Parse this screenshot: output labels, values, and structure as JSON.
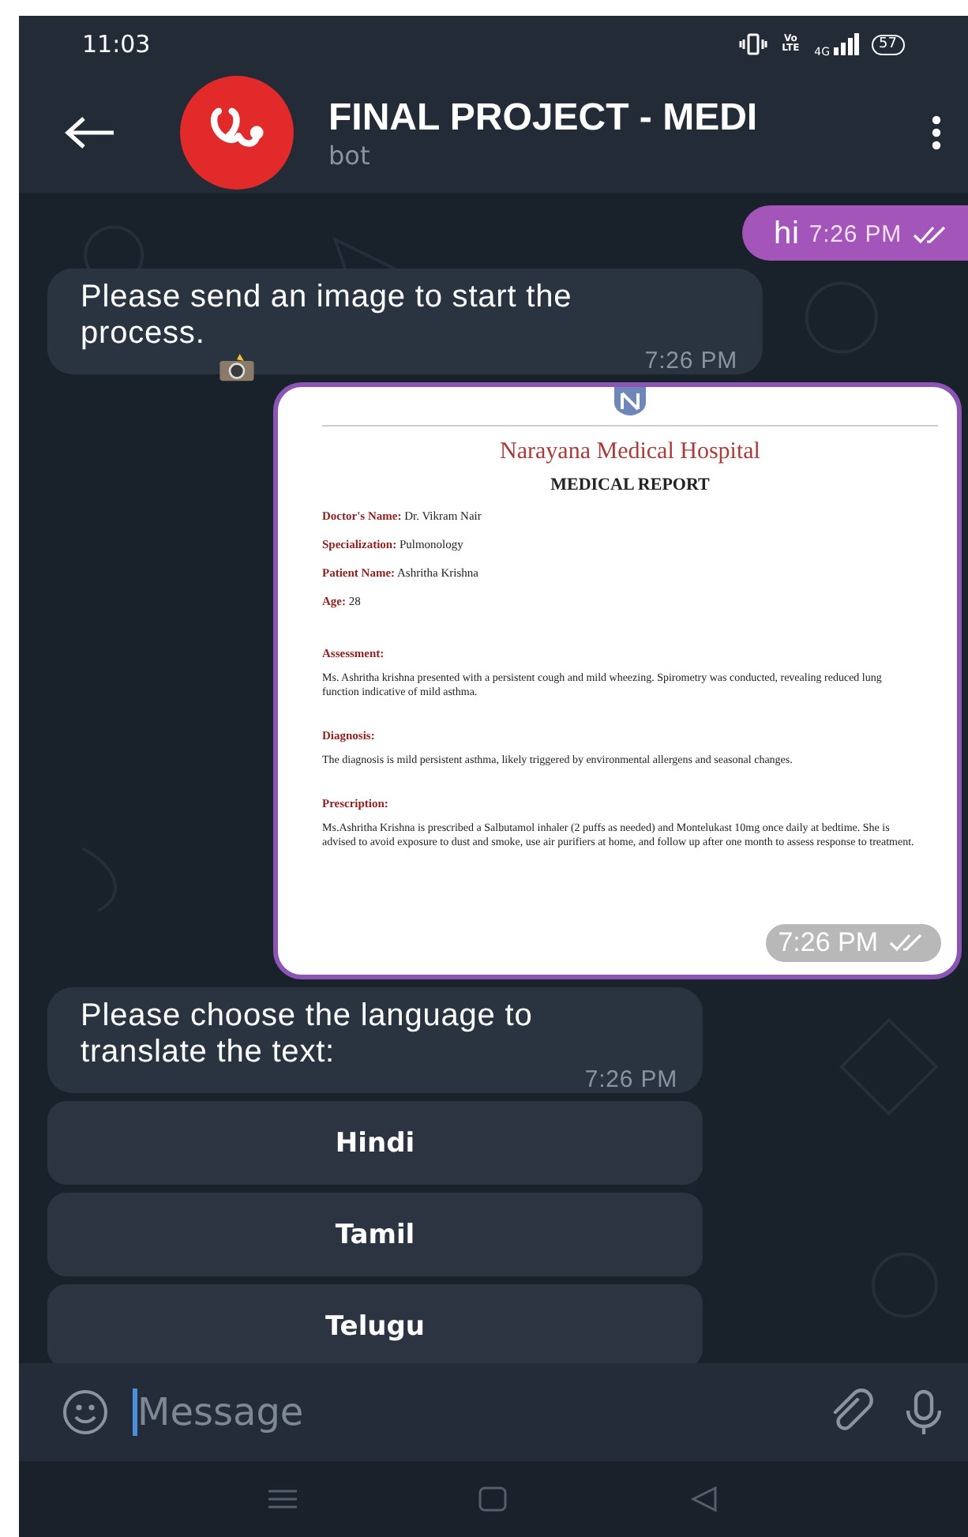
{
  "status_bar": {
    "time": "11:03",
    "volte": "Vo LTE",
    "network": "4G",
    "battery": "57"
  },
  "header": {
    "title": "FINAL PROJECT - MEDI",
    "subtitle": "bot"
  },
  "messages": [
    {
      "kind": "text",
      "outgoing": true,
      "text": "hi",
      "time": "7:26 PM",
      "read": true
    },
    {
      "kind": "text",
      "outgoing": false,
      "text": "Please send an image to start the process.",
      "time": "7:26 PM"
    },
    {
      "kind": "image",
      "outgoing": true,
      "time": "7:26 PM",
      "read": true,
      "document": {
        "hospital": "Narayana Medical Hospital",
        "title": "MEDICAL REPORT",
        "fields": [
          {
            "label": "Doctor's Name:",
            "value": "Dr. Vikram Nair"
          },
          {
            "label": "Specialization:",
            "value": "Pulmonology"
          },
          {
            "label": "Patient Name:",
            "value": "Ashritha Krishna"
          },
          {
            "label": "Age:",
            "value": "28"
          }
        ],
        "sections": [
          {
            "heading": "Assessment:",
            "text": "Ms. Ashritha krishna presented with a persistent cough and mild wheezing. Spirometry was conducted, revealing reduced lung function indicative of mild asthma."
          },
          {
            "heading": "Diagnosis:",
            "text": "The diagnosis is mild persistent asthma, likely triggered by environmental allergens and seasonal changes."
          },
          {
            "heading": "Prescription:",
            "text": "Ms.Ashritha Krishna is prescribed a Salbutamol inhaler (2 puffs as needed) and Montelukast 10mg once daily at bedtime. She is advised to avoid exposure to dust and smoke, use air purifiers at home, and follow up after one month to assess response to treatment."
          }
        ]
      }
    },
    {
      "kind": "text",
      "outgoing": false,
      "text": "Please choose the language to translate the text:",
      "time": "7:26 PM"
    }
  ],
  "keyboard_buttons": [
    "Hindi",
    "Tamil",
    "Telugu"
  ],
  "composer": {
    "placeholder": "Message"
  }
}
